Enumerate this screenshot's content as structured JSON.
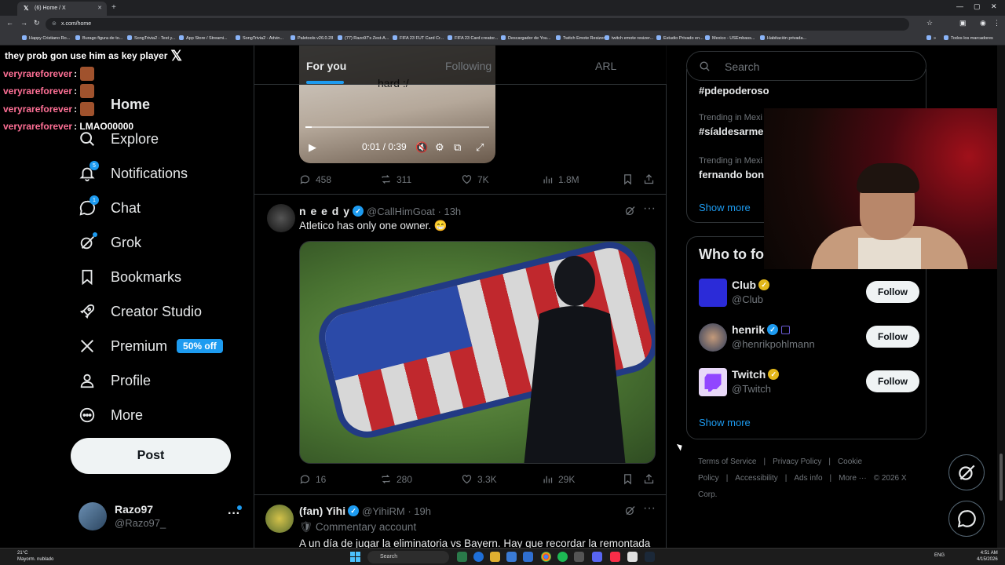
{
  "browser": {
    "tab_title": "(6) Home / X",
    "url": "x.com/home",
    "bookmarks": [
      "Happy Cristiano Ro...",
      "Burago figura de to...",
      "SongTrivia2 - Test y...",
      "App Store / Streami...",
      "SongTrivia2 - Advin...",
      "Paletools v26.0.28",
      "(77) Razo97's Zest-A...",
      "FIFA 23 FUT Card Cr...",
      "FIFA 23 Card creator...",
      "Descargador de You...",
      "Twitch Emote Resizer",
      "twitch emote resizer...",
      "Estudio Privado en...",
      "Mexico - USEmbass...",
      "Habitación privada..."
    ],
    "bookmarks_more": "»",
    "all_bookmarks": "Todos los marcadores"
  },
  "chat": [
    {
      "user": "",
      "text": "they prob gon use him as key player",
      "emote": "x-emote"
    },
    {
      "user": "veryrareforever",
      "text": ":",
      "emote": "emote"
    },
    {
      "user": "veryrareforever",
      "text": ":",
      "emote": "emote"
    },
    {
      "user": "veryrareforever",
      "text": ":",
      "emote": "emote"
    },
    {
      "user": "veryrareforever",
      "text": ": LMAO00000",
      "emote": ""
    }
  ],
  "nav": {
    "home": "Home",
    "explore": "Explore",
    "notifications": "Notifications",
    "notifications_badge": "5",
    "chat": "Chat",
    "chat_badge": "1",
    "grok": "Grok",
    "bookmarks": "Bookmarks",
    "creator_studio": "Creator Studio",
    "premium": "Premium",
    "premium_badge": "50% off",
    "profile": "Profile",
    "more": "More",
    "post": "Post"
  },
  "account": {
    "name": "Razo97",
    "handle": "@Razo97_",
    "more": "···"
  },
  "timeline": {
    "tabs": [
      "For you",
      "Following",
      "ARL"
    ],
    "post1": {
      "caption": "hard :/",
      "time": "0:01 / 0:39",
      "replies": "458",
      "reposts": "311",
      "likes": "7K",
      "views": "1.8M"
    },
    "post2": {
      "name": "n e e d y",
      "handle": "@CallHimGoat · 13h",
      "text": "Atletico has only one owner. 😁",
      "replies": "16",
      "reposts": "280",
      "likes": "3.3K",
      "views": "29K"
    },
    "post3": {
      "name": "(fan) Yihi",
      "handle": "@YihiRM · 19h",
      "subtitle": "🛡 Commentary account",
      "text": "A un día de jugar la eliminatoria vs Bayern. Hay que recordar la remontada"
    }
  },
  "sidebar": {
    "search_placeholder": "Search",
    "trends": [
      {
        "meta": "",
        "tag": "#pdepoderoso"
      },
      {
        "meta": "Trending in Mexi",
        "tag": "#síaldesarme"
      },
      {
        "meta": "Trending in Mexi",
        "tag": "fernando bon"
      }
    ],
    "show_more": "Show more",
    "wtf_title": "Who to fol",
    "who_to_follow": [
      {
        "name": "Club",
        "handle": "@Club",
        "badge": "gold"
      },
      {
        "name": "henrik",
        "handle": "@henrikpohlmann",
        "badge": "blue"
      },
      {
        "name": "Twitch",
        "handle": "@Twitch",
        "badge": "gold"
      }
    ],
    "follow_label": "Follow",
    "show_more_2": "Show more",
    "footer": [
      "Terms of Service",
      "|",
      "Privacy Policy",
      "|",
      "Cookie Policy",
      "|",
      "Accessibility",
      "|",
      "Ads info",
      "|",
      "More ···",
      "© 2026 X Corp."
    ]
  },
  "taskbar": {
    "temp": "21°C",
    "weather": "Mayorm. nublado",
    "search": "Search",
    "lang": "ENG",
    "time": "4:51 AM",
    "date": "4/15/2026"
  }
}
